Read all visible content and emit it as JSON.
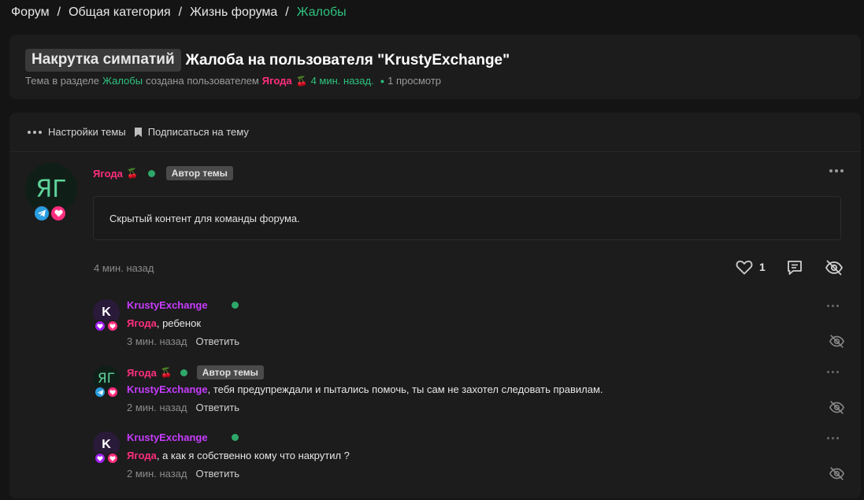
{
  "breadcrumb": [
    {
      "label": "Форум"
    },
    {
      "label": "Общая категория"
    },
    {
      "label": "Жизнь форума"
    },
    {
      "label": "Жалобы"
    }
  ],
  "breadcrumb_sep": "/",
  "thread": {
    "prefix": "Накрутка симпатий",
    "title": "Жалоба на пользователя \"KrustyExchange\"",
    "meta_prefix": "Тема в разделе",
    "meta_section": "Жалобы",
    "meta_created_by": "создана пользователем",
    "meta_author": "Ягода",
    "meta_time": "4 мин. назад.",
    "meta_views": "1 просмотр"
  },
  "toolbar": {
    "settings_label": "Настройки темы",
    "subscribe_label": "Подписаться на тему"
  },
  "post": {
    "avatar_initials": "ЯГ",
    "author": "Ягода",
    "author_badge": "Автор темы",
    "content": "Скрытый контент для команды форума.",
    "time": "4 мин. назад",
    "likes": "1"
  },
  "comments": [
    {
      "avatar": "K",
      "author": "KrustyExchange",
      "mention": "Ягода",
      "text": ", ребенок",
      "time": "3 мин. назад",
      "reply_label": "Ответить"
    },
    {
      "avatar": "ЯГ",
      "author": "Ягода",
      "author_badge": "Автор темы",
      "mention": "KrustyExchange",
      "text": ", тебя предупреждали и пытались помочь, ты сам не захотел следовать правилам.",
      "time": "2 мин. назад",
      "reply_label": "Ответить"
    },
    {
      "avatar": "K",
      "author": "KrustyExchange",
      "mention": "Ягода",
      "text": ", а как я собственно кому что накрутил ?",
      "time": "2 мин. назад",
      "reply_label": "Ответить"
    }
  ],
  "colors": {
    "background": "#141414",
    "card": "#1c1c1c",
    "accent_green": "#2ec27e",
    "user_pink": "#ff2e7e",
    "user_purple": "#c83cff"
  },
  "icons": [
    "more-dots-icon",
    "bookmark-icon",
    "heart-icon",
    "comment-icon",
    "eye-off-icon",
    "telegram-icon",
    "cherry-icon"
  ]
}
